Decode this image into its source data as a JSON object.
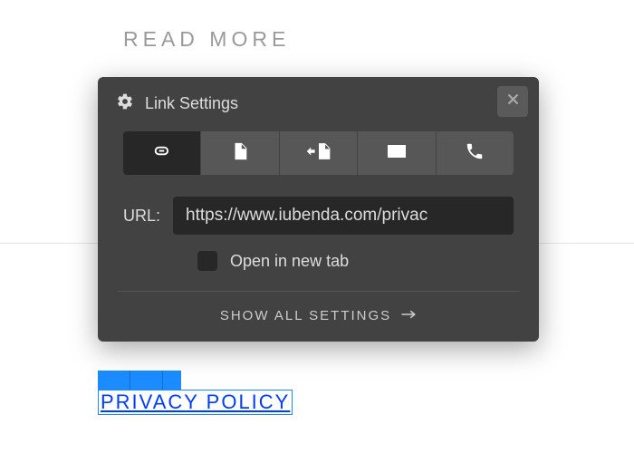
{
  "page": {
    "read_more": "READ MORE",
    "privacy_link_text": "PRIVACY POLICY"
  },
  "popup": {
    "title": "Link Settings",
    "tabs": {
      "link": "link-icon",
      "page": "page-icon",
      "anchor": "anchor-icon",
      "email": "email-icon",
      "phone": "phone-icon"
    },
    "url_label": "URL:",
    "url_value": "https://www.iubenda.com/privac",
    "open_new_tab_label": "Open in new tab",
    "show_all_label": "SHOW ALL SETTINGS"
  }
}
